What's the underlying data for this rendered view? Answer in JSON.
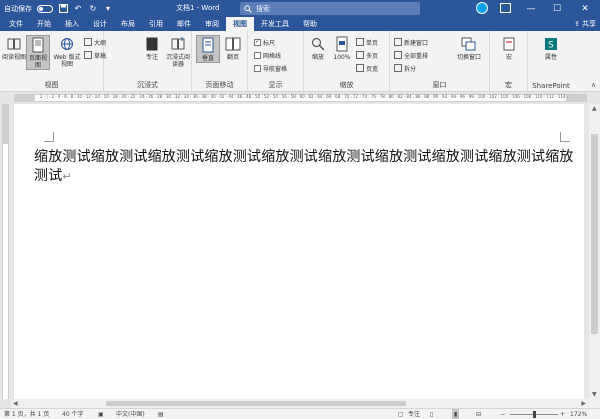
{
  "titlebar": {
    "autosave_label": "自动保存",
    "autosave_state": "关",
    "doc_title": "文档1 - Word",
    "search_placeholder": "搜索",
    "minimize": "—",
    "maximize": "☐",
    "close": "✕"
  },
  "tabs": [
    {
      "label": "文件"
    },
    {
      "label": "开始"
    },
    {
      "label": "插入"
    },
    {
      "label": "设计"
    },
    {
      "label": "布局"
    },
    {
      "label": "引用"
    },
    {
      "label": "邮件"
    },
    {
      "label": "审阅"
    },
    {
      "label": "视图",
      "active": true
    },
    {
      "label": "开发工具"
    },
    {
      "label": "帮助"
    }
  ],
  "share_label": "共享",
  "ribbon": {
    "views": {
      "label": "视图",
      "read_mode": "阅读视图",
      "print_layout": "页面视图",
      "web_layout": "Web 版式视图",
      "outline": "大纲",
      "draft": "草稿"
    },
    "immersive": {
      "label": "沉浸式",
      "focus": "专注",
      "immersive_reader": "沉浸式阅读器"
    },
    "page_movement": {
      "label": "页面移动",
      "vertical": "垂直",
      "side_to_side": "翻页"
    },
    "show": {
      "label": "显示",
      "ruler": "标尺",
      "ruler_checked": true,
      "gridlines": "网格线",
      "gridlines_checked": false,
      "navigation_pane": "导航窗格",
      "navigation_checked": false
    },
    "zoom": {
      "label": "缩放",
      "zoom": "缩放",
      "hundred": "100%",
      "one_page": "单页",
      "multiple_pages": "多页",
      "page_width": "页宽"
    },
    "window": {
      "label": "窗口",
      "new_window": "新建窗口",
      "arrange_all": "全部重排",
      "split": "拆分",
      "switch_windows": "切换窗口"
    },
    "macros": {
      "label": "宏",
      "macros": "宏"
    },
    "sharepoint": {
      "label": "SharePoint",
      "properties": "属性"
    }
  },
  "ruler_ticks": "2 · | · 2 · 4 · 6 · 8 · 10 · 12 · 14 · 16 · 18 · 20 · 22 · 24 · 26 · 28 · 30 · 32 · 34 · 36 · 38 · 40 · 42 · 44 · 46 · 48 · 50 · 52 · 54 · 56 · 58 · 60 · 62 · 64 · 66 · 68 · 70 · 72 · 74 · 76 · 78 · 80 · 82 · 84 · 86 · 88 · 90 · 92 · 94 · 96 · 98 · 100 · 102 · 104 · 106 · 108 · 110 · 112 · 114 · 116 · 118 · 120 · 122 · 124 · 126 · 128 · 130 · 132 · 134 · 136 · | · 140 · 142",
  "document": {
    "text": "缩放测试缩放测试缩放测试缩放测试缩放测试缩放测试缩放测试缩放测试缩放测试缩放测试",
    "paragraph_mark": "↵"
  },
  "statusbar": {
    "page": "第 1 页，共 1 页",
    "words": "40 个字",
    "language": "中文(中国)",
    "focus": "专注",
    "zoom_minus": "−",
    "zoom_plus": "+",
    "zoom_level": "172%",
    "zoom_fraction": 0.5
  },
  "colors": {
    "brand": "#2b579a",
    "ribbon_bg": "#f3f3f3",
    "canvas_bg": "#e6e6e6"
  }
}
